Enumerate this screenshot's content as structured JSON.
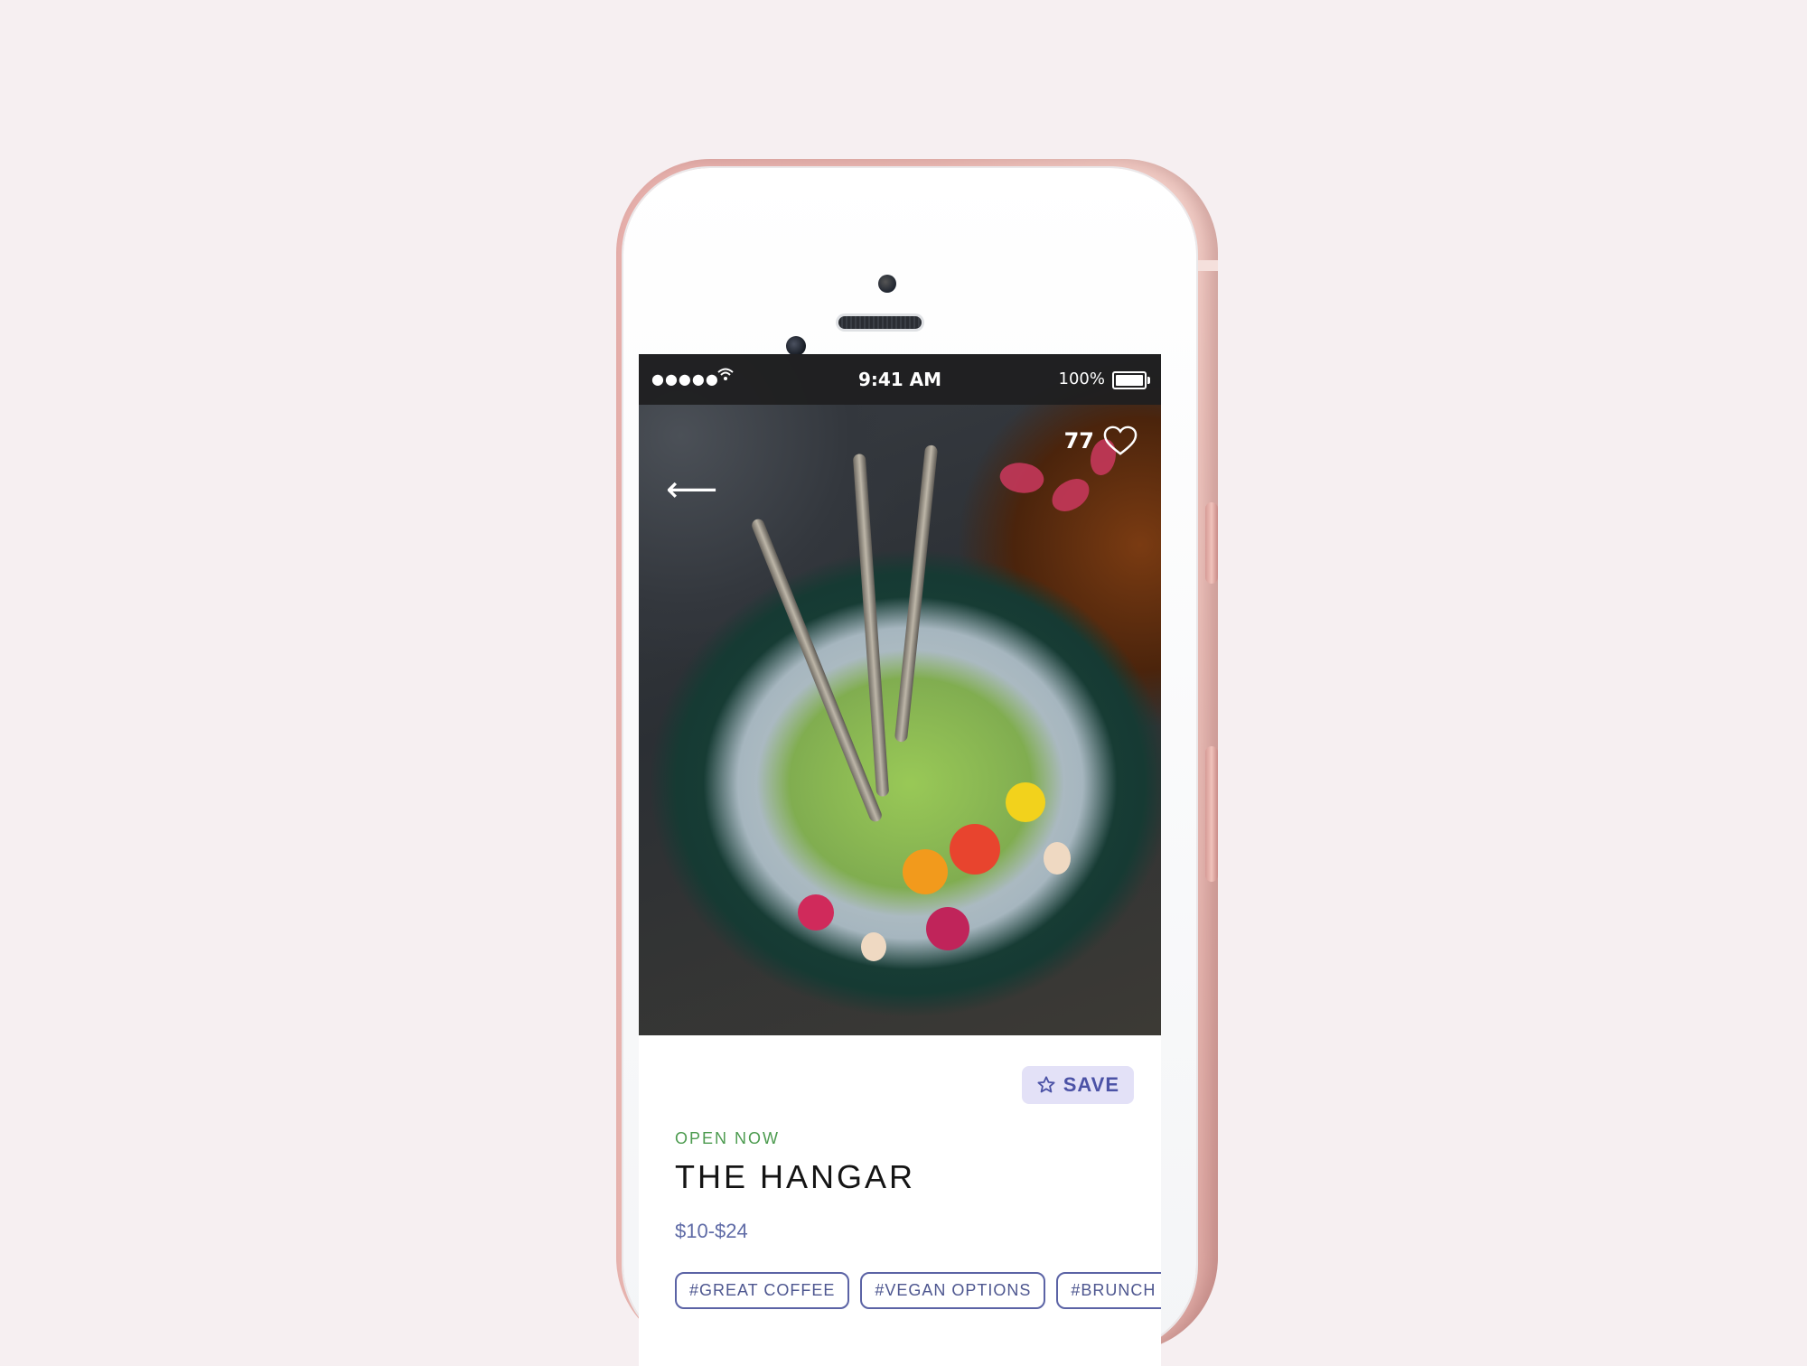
{
  "status_bar": {
    "signal": "●●●●●",
    "wifi_icon": "wifi-icon",
    "time": "9:41 AM",
    "battery_percent": "100%",
    "battery_level": 1.0
  },
  "header": {
    "back_icon": "back-arrow-icon",
    "back_glyph": "⟵",
    "likes_count": "77",
    "heart_icon": "heart-icon"
  },
  "card": {
    "save_label": "SAVE",
    "save_icon": "star-icon",
    "status": "OPEN NOW",
    "title": "THE HANGAR",
    "price_range": "$10-$24",
    "tags": [
      "#GREAT COFFEE",
      "#VEGAN OPTIONS",
      "#BRUNCH"
    ]
  },
  "colors": {
    "open_status": "#4c9b4f",
    "accent": "#4b52a6",
    "save_bg": "#e3e1f7",
    "device_frame": "#ecbbb5"
  }
}
